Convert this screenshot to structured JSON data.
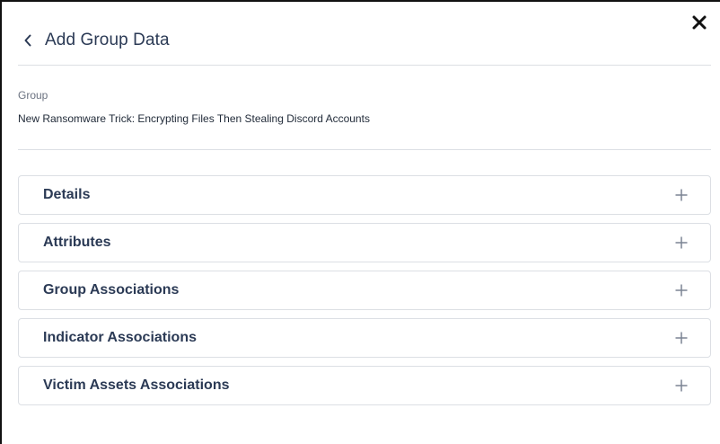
{
  "dialog": {
    "title": "Add Group Data",
    "back_icon": "chevron-left-icon",
    "close_icon": "close-icon"
  },
  "group": {
    "label": "Group",
    "value": "New Ransomware Trick: Encrypting Files Then Stealing Discord Accounts"
  },
  "sections": [
    {
      "label": "Details",
      "icon": "plus-icon"
    },
    {
      "label": "Attributes",
      "icon": "plus-icon"
    },
    {
      "label": "Group Associations",
      "icon": "plus-icon"
    },
    {
      "label": "Indicator Associations",
      "icon": "plus-icon"
    },
    {
      "label": "Victim Assets Associations",
      "icon": "plus-icon"
    }
  ],
  "colors": {
    "text_primary": "#2b3a55",
    "border": "#dcdfe4",
    "muted": "#6b7280"
  }
}
